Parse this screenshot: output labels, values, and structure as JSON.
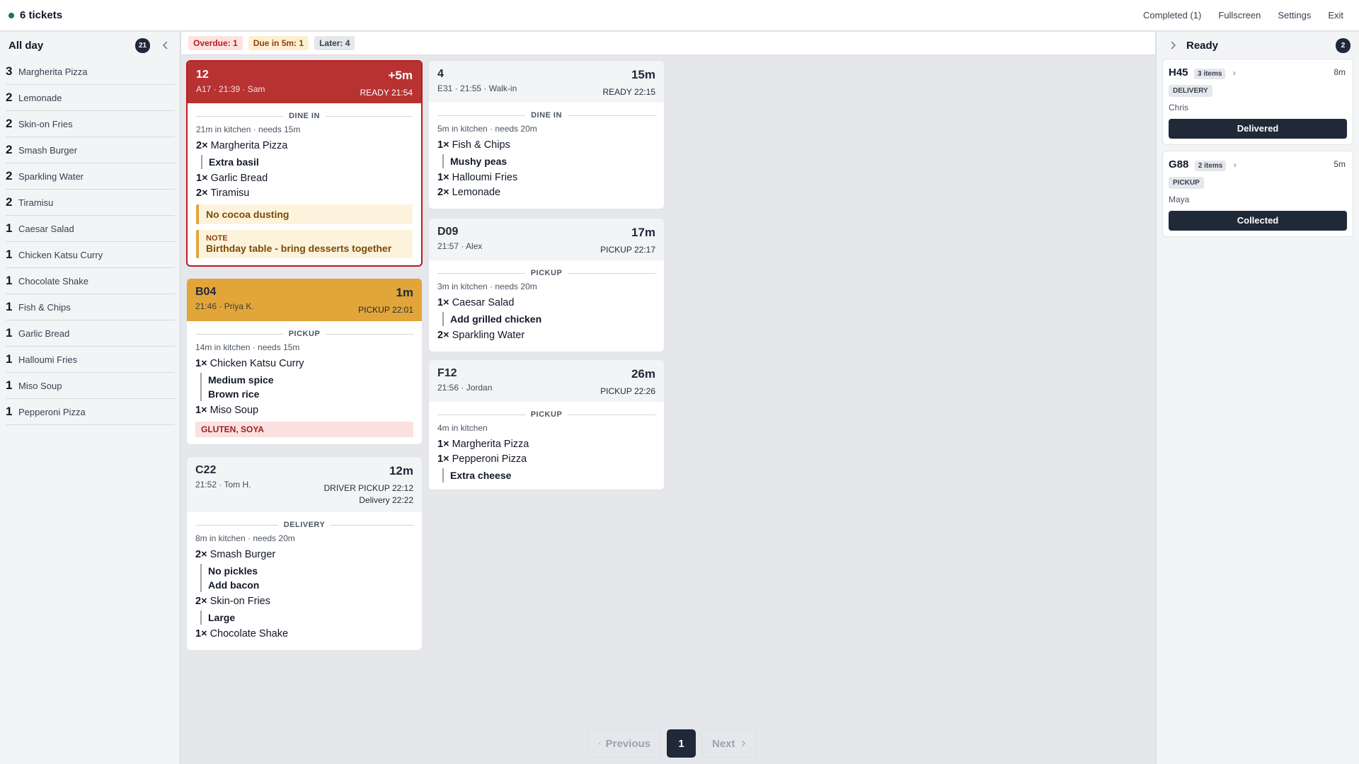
{
  "topbar": {
    "title": "6 tickets",
    "completed": "Completed (1)",
    "fullscreen": "Fullscreen",
    "settings": "Settings",
    "exit": "Exit"
  },
  "allday": {
    "label": "All day",
    "count": "21",
    "items": [
      {
        "qty": "3",
        "name": "Margherita Pizza"
      },
      {
        "qty": "2",
        "name": "Lemonade"
      },
      {
        "qty": "2",
        "name": "Skin-on Fries"
      },
      {
        "qty": "2",
        "name": "Smash Burger"
      },
      {
        "qty": "2",
        "name": "Sparkling Water"
      },
      {
        "qty": "2",
        "name": "Tiramisu"
      },
      {
        "qty": "1",
        "name": "Caesar Salad"
      },
      {
        "qty": "1",
        "name": "Chicken Katsu Curry"
      },
      {
        "qty": "1",
        "name": "Chocolate Shake"
      },
      {
        "qty": "1",
        "name": "Fish & Chips"
      },
      {
        "qty": "1",
        "name": "Garlic Bread"
      },
      {
        "qty": "1",
        "name": "Halloumi Fries"
      },
      {
        "qty": "1",
        "name": "Miso Soup"
      },
      {
        "qty": "1",
        "name": "Pepperoni Pizza"
      }
    ]
  },
  "filters": {
    "overdue": "Overdue: 1",
    "due": "Due in 5m: 1",
    "later": "Later: 4"
  },
  "tickets": {
    "t12": {
      "id": "12",
      "elapsed": "+5m",
      "sub": "A17 · 21:39 · Sam",
      "ready": "READY 21:54",
      "type": "DINE IN",
      "meta": "21m in kitchen · needs 15m",
      "items": [
        {
          "qty": "2×",
          "name": "Margherita Pizza",
          "mods": [
            "Extra basil"
          ]
        },
        {
          "qty": "1×",
          "name": "Garlic Bread"
        },
        {
          "qty": "2×",
          "name": "Tiramisu"
        }
      ],
      "item_note": "No cocoa dusting",
      "note_head": "NOTE",
      "note": "Birthday table - bring desserts together"
    },
    "b04": {
      "id": "B04",
      "elapsed": "1m",
      "sub": "21:46 · Priya K.",
      "ready": "PICKUP 22:01",
      "type": "PICKUP",
      "meta": "14m in kitchen · needs 15m",
      "items": [
        {
          "qty": "1×",
          "name": "Chicken Katsu Curry",
          "mods": [
            "Medium spice",
            "Brown rice"
          ]
        },
        {
          "qty": "1×",
          "name": "Miso Soup"
        }
      ],
      "allergens": "GLUTEN, SOYA"
    },
    "c22": {
      "id": "C22",
      "elapsed": "12m",
      "sub": "21:52 · Tom H.",
      "ready": "DRIVER PICKUP 22:12",
      "ready2": "Delivery 22:22",
      "type": "DELIVERY",
      "meta": "8m in kitchen · needs 20m",
      "items": [
        {
          "qty": "2×",
          "name": "Smash Burger",
          "mods": [
            "No pickles",
            "Add bacon"
          ]
        },
        {
          "qty": "2×",
          "name": "Skin-on Fries",
          "mods": [
            "Large"
          ]
        },
        {
          "qty": "1×",
          "name": "Chocolate Shake"
        }
      ]
    },
    "t4": {
      "id": "4",
      "elapsed": "15m",
      "sub": "E31 · 21:55 · Walk-in",
      "ready": "READY 22:15",
      "type": "DINE IN",
      "meta": "5m in kitchen · needs 20m",
      "items": [
        {
          "qty": "1×",
          "name": "Fish & Chips",
          "mods": [
            "Mushy peas"
          ]
        },
        {
          "qty": "1×",
          "name": "Halloumi Fries"
        },
        {
          "qty": "2×",
          "name": "Lemonade"
        }
      ]
    },
    "d09": {
      "id": "D09",
      "elapsed": "17m",
      "sub": "21:57 · Alex",
      "ready": "PICKUP 22:17",
      "type": "PICKUP",
      "meta": "3m in kitchen · needs 20m",
      "items": [
        {
          "qty": "1×",
          "name": "Caesar Salad",
          "mods": [
            "Add grilled chicken"
          ]
        },
        {
          "qty": "2×",
          "name": "Sparkling Water"
        }
      ]
    },
    "f12": {
      "id": "F12",
      "elapsed": "26m",
      "sub": "21:56 · Jordan",
      "ready": "PICKUP 22:26",
      "type": "PICKUP",
      "meta": "4m in kitchen",
      "items": [
        {
          "qty": "1×",
          "name": "Margherita Pizza"
        },
        {
          "qty": "1×",
          "name": "Pepperoni Pizza",
          "mods": [
            "Extra cheese"
          ]
        }
      ]
    }
  },
  "ready_panel": {
    "label": "Ready",
    "count": "2",
    "cards": [
      {
        "id": "H45",
        "items": "3 items",
        "time": "8m",
        "type": "DELIVERY",
        "name": "Chris",
        "button": "Delivered"
      },
      {
        "id": "G88",
        "items": "2 items",
        "time": "5m",
        "type": "PICKUP",
        "name": "Maya",
        "button": "Collected"
      }
    ]
  },
  "pager": {
    "prev": "Previous",
    "current": "1",
    "next": "Next"
  },
  "colors": {
    "overdue": "#b83232",
    "due": "#e2a53a",
    "dark": "#1f2937"
  }
}
